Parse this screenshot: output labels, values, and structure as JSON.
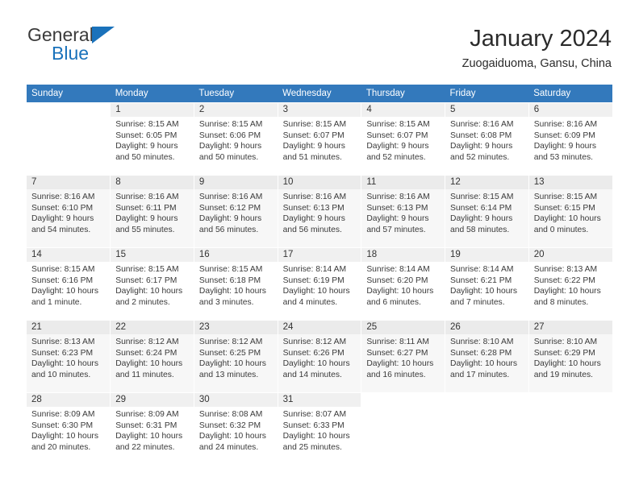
{
  "brand": {
    "name_dark": "General",
    "name_blue": "Blue",
    "accent_color": "#1a72bb"
  },
  "header": {
    "title": "January 2024",
    "subtitle": "Zuogaiduoma, Gansu, China"
  },
  "theme": {
    "header_row_bg": "#3379bc",
    "header_row_text": "#ffffff",
    "daynum_bg": "#f0f0f0",
    "shaded_row_bg": "#f7f7f7"
  },
  "weekday_headers": [
    "Sunday",
    "Monday",
    "Tuesday",
    "Wednesday",
    "Thursday",
    "Friday",
    "Saturday"
  ],
  "weeks": [
    {
      "shaded": false,
      "days": [
        {
          "empty": true
        },
        {
          "day": "1",
          "sunrise": "Sunrise: 8:15 AM",
          "sunset": "Sunset: 6:05 PM",
          "daylight": "Daylight: 9 hours and 50 minutes."
        },
        {
          "day": "2",
          "sunrise": "Sunrise: 8:15 AM",
          "sunset": "Sunset: 6:06 PM",
          "daylight": "Daylight: 9 hours and 50 minutes."
        },
        {
          "day": "3",
          "sunrise": "Sunrise: 8:15 AM",
          "sunset": "Sunset: 6:07 PM",
          "daylight": "Daylight: 9 hours and 51 minutes."
        },
        {
          "day": "4",
          "sunrise": "Sunrise: 8:15 AM",
          "sunset": "Sunset: 6:07 PM",
          "daylight": "Daylight: 9 hours and 52 minutes."
        },
        {
          "day": "5",
          "sunrise": "Sunrise: 8:16 AM",
          "sunset": "Sunset: 6:08 PM",
          "daylight": "Daylight: 9 hours and 52 minutes."
        },
        {
          "day": "6",
          "sunrise": "Sunrise: 8:16 AM",
          "sunset": "Sunset: 6:09 PM",
          "daylight": "Daylight: 9 hours and 53 minutes."
        }
      ]
    },
    {
      "shaded": true,
      "days": [
        {
          "day": "7",
          "sunrise": "Sunrise: 8:16 AM",
          "sunset": "Sunset: 6:10 PM",
          "daylight": "Daylight: 9 hours and 54 minutes."
        },
        {
          "day": "8",
          "sunrise": "Sunrise: 8:16 AM",
          "sunset": "Sunset: 6:11 PM",
          "daylight": "Daylight: 9 hours and 55 minutes."
        },
        {
          "day": "9",
          "sunrise": "Sunrise: 8:16 AM",
          "sunset": "Sunset: 6:12 PM",
          "daylight": "Daylight: 9 hours and 56 minutes."
        },
        {
          "day": "10",
          "sunrise": "Sunrise: 8:16 AM",
          "sunset": "Sunset: 6:13 PM",
          "daylight": "Daylight: 9 hours and 56 minutes."
        },
        {
          "day": "11",
          "sunrise": "Sunrise: 8:16 AM",
          "sunset": "Sunset: 6:13 PM",
          "daylight": "Daylight: 9 hours and 57 minutes."
        },
        {
          "day": "12",
          "sunrise": "Sunrise: 8:15 AM",
          "sunset": "Sunset: 6:14 PM",
          "daylight": "Daylight: 9 hours and 58 minutes."
        },
        {
          "day": "13",
          "sunrise": "Sunrise: 8:15 AM",
          "sunset": "Sunset: 6:15 PM",
          "daylight": "Daylight: 10 hours and 0 minutes."
        }
      ]
    },
    {
      "shaded": false,
      "days": [
        {
          "day": "14",
          "sunrise": "Sunrise: 8:15 AM",
          "sunset": "Sunset: 6:16 PM",
          "daylight": "Daylight: 10 hours and 1 minute."
        },
        {
          "day": "15",
          "sunrise": "Sunrise: 8:15 AM",
          "sunset": "Sunset: 6:17 PM",
          "daylight": "Daylight: 10 hours and 2 minutes."
        },
        {
          "day": "16",
          "sunrise": "Sunrise: 8:15 AM",
          "sunset": "Sunset: 6:18 PM",
          "daylight": "Daylight: 10 hours and 3 minutes."
        },
        {
          "day": "17",
          "sunrise": "Sunrise: 8:14 AM",
          "sunset": "Sunset: 6:19 PM",
          "daylight": "Daylight: 10 hours and 4 minutes."
        },
        {
          "day": "18",
          "sunrise": "Sunrise: 8:14 AM",
          "sunset": "Sunset: 6:20 PM",
          "daylight": "Daylight: 10 hours and 6 minutes."
        },
        {
          "day": "19",
          "sunrise": "Sunrise: 8:14 AM",
          "sunset": "Sunset: 6:21 PM",
          "daylight": "Daylight: 10 hours and 7 minutes."
        },
        {
          "day": "20",
          "sunrise": "Sunrise: 8:13 AM",
          "sunset": "Sunset: 6:22 PM",
          "daylight": "Daylight: 10 hours and 8 minutes."
        }
      ]
    },
    {
      "shaded": true,
      "days": [
        {
          "day": "21",
          "sunrise": "Sunrise: 8:13 AM",
          "sunset": "Sunset: 6:23 PM",
          "daylight": "Daylight: 10 hours and 10 minutes."
        },
        {
          "day": "22",
          "sunrise": "Sunrise: 8:12 AM",
          "sunset": "Sunset: 6:24 PM",
          "daylight": "Daylight: 10 hours and 11 minutes."
        },
        {
          "day": "23",
          "sunrise": "Sunrise: 8:12 AM",
          "sunset": "Sunset: 6:25 PM",
          "daylight": "Daylight: 10 hours and 13 minutes."
        },
        {
          "day": "24",
          "sunrise": "Sunrise: 8:12 AM",
          "sunset": "Sunset: 6:26 PM",
          "daylight": "Daylight: 10 hours and 14 minutes."
        },
        {
          "day": "25",
          "sunrise": "Sunrise: 8:11 AM",
          "sunset": "Sunset: 6:27 PM",
          "daylight": "Daylight: 10 hours and 16 minutes."
        },
        {
          "day": "26",
          "sunrise": "Sunrise: 8:10 AM",
          "sunset": "Sunset: 6:28 PM",
          "daylight": "Daylight: 10 hours and 17 minutes."
        },
        {
          "day": "27",
          "sunrise": "Sunrise: 8:10 AM",
          "sunset": "Sunset: 6:29 PM",
          "daylight": "Daylight: 10 hours and 19 minutes."
        }
      ]
    },
    {
      "shaded": false,
      "days": [
        {
          "day": "28",
          "sunrise": "Sunrise: 8:09 AM",
          "sunset": "Sunset: 6:30 PM",
          "daylight": "Daylight: 10 hours and 20 minutes."
        },
        {
          "day": "29",
          "sunrise": "Sunrise: 8:09 AM",
          "sunset": "Sunset: 6:31 PM",
          "daylight": "Daylight: 10 hours and 22 minutes."
        },
        {
          "day": "30",
          "sunrise": "Sunrise: 8:08 AM",
          "sunset": "Sunset: 6:32 PM",
          "daylight": "Daylight: 10 hours and 24 minutes."
        },
        {
          "day": "31",
          "sunrise": "Sunrise: 8:07 AM",
          "sunset": "Sunset: 6:33 PM",
          "daylight": "Daylight: 10 hours and 25 minutes."
        },
        {
          "empty": true
        },
        {
          "empty": true
        },
        {
          "empty": true
        }
      ]
    }
  ]
}
